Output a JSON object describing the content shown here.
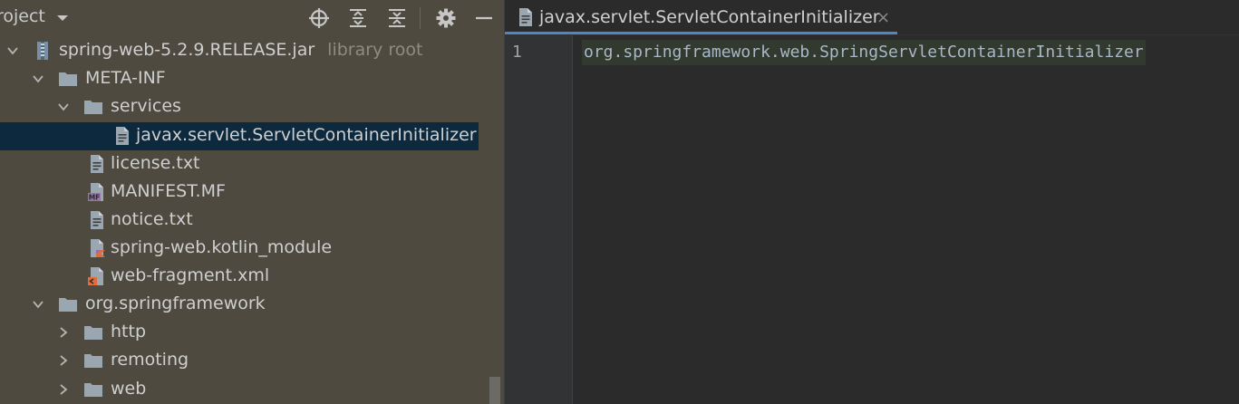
{
  "project_panel": {
    "title": "roject",
    "tree": [
      {
        "label": "spring-web-5.2.9.RELEASE.jar",
        "hint": "library root",
        "icon": "jar-icon",
        "expanded": true
      },
      {
        "label": "META-INF",
        "icon": "folder-icon",
        "expanded": true
      },
      {
        "label": "services",
        "icon": "folder-icon",
        "expanded": true
      },
      {
        "label": "javax.servlet.ServletContainerInitializer",
        "icon": "text-file-icon",
        "selected": true
      },
      {
        "label": "license.txt",
        "icon": "text-file-icon"
      },
      {
        "label": "MANIFEST.MF",
        "icon": "manifest-file-icon"
      },
      {
        "label": "notice.txt",
        "icon": "text-file-icon"
      },
      {
        "label": "spring-web.kotlin_module",
        "icon": "kotlin-module-file-icon"
      },
      {
        "label": "web-fragment.xml",
        "icon": "xml-file-icon"
      },
      {
        "label": "org.springframework",
        "icon": "package-icon",
        "expanded": true
      },
      {
        "label": "http",
        "icon": "package-icon",
        "expanded": false
      },
      {
        "label": "remoting",
        "icon": "package-icon",
        "expanded": false
      },
      {
        "label": "web",
        "icon": "package-icon",
        "expanded": false
      }
    ]
  },
  "editor": {
    "tab_label": "javax.servlet.ServletContainerInitializer",
    "tab_close": "×",
    "line_number": "1",
    "code_line": "org.springframework.web.SpringServletContainerInitializer"
  },
  "colors": {
    "panel_bg": "#4e4a40",
    "selection_bg": "#0d293e",
    "editor_bg": "#2b2b2b",
    "tab_underline": "#4a88c7"
  }
}
